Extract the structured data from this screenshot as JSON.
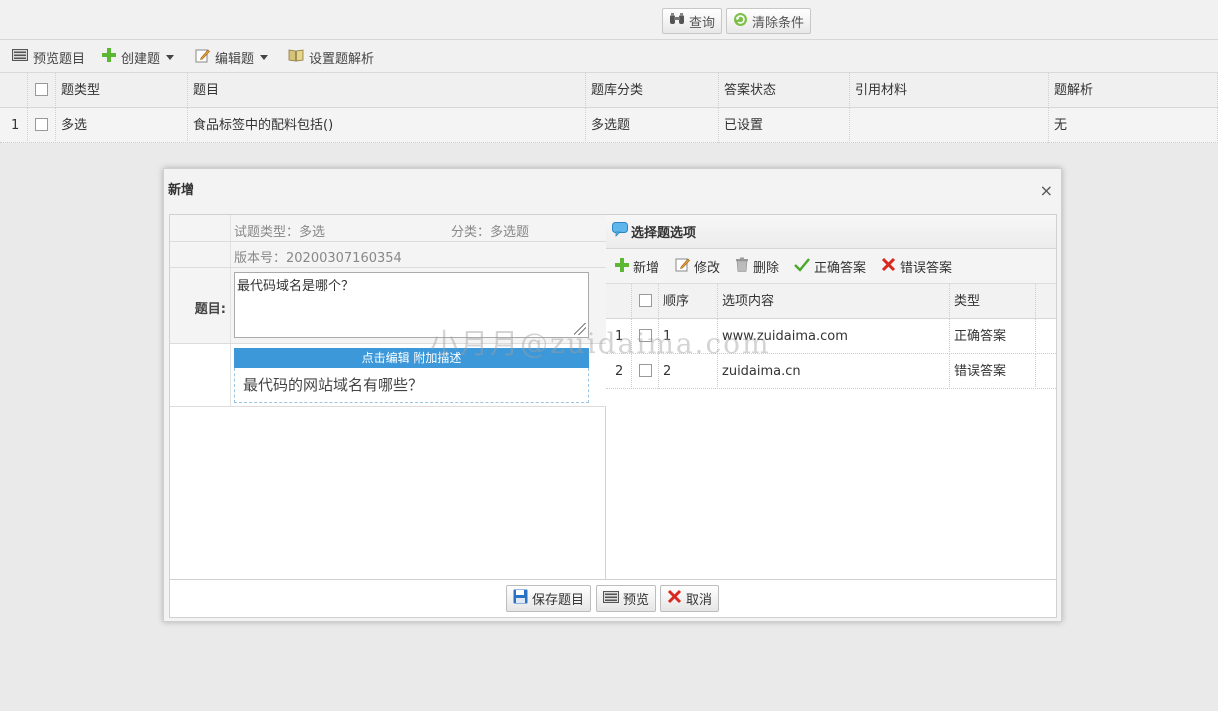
{
  "search": {
    "query_label": "查询",
    "clear_label": "清除条件"
  },
  "toolbar": {
    "preview_label": "预览题目",
    "create_label": "创建题",
    "edit_label": "编辑题",
    "analysis_label": "设置题解析"
  },
  "grid": {
    "columns": [
      "题类型",
      "题目",
      "题库分类",
      "答案状态",
      "引用材料",
      "题解析"
    ],
    "rows": [
      {
        "index": "1",
        "type": "多选",
        "title": "食品标签中的配料包括()",
        "category": "多选题",
        "answer_status": "已设置",
        "material": "",
        "analysis": "无"
      }
    ]
  },
  "dialog": {
    "title": "新增",
    "close": "×",
    "type_line": "试题类型：多选",
    "category_line": "分类：多选题",
    "version_line": "版本号：20200307160354",
    "question_label": "题目:",
    "question_value": "最代码域名是哪个？",
    "edit_bar": "点击编辑 附加描述",
    "description": "最代码的网站域名有哪些？",
    "options_panel": {
      "title": "选择题选项",
      "tools": {
        "add": "新增",
        "modify": "修改",
        "delete": "删除",
        "correct": "正确答案",
        "wrong": "错误答案"
      },
      "columns": [
        "顺序",
        "选项内容",
        "类型"
      ],
      "rows": [
        {
          "index": "1",
          "order": "1",
          "content": "www.zuidaima.com",
          "type": "正确答案"
        },
        {
          "index": "2",
          "order": "2",
          "content": "zuidaima.cn",
          "type": "错误答案"
        }
      ]
    },
    "footer": {
      "save": "保存题目",
      "preview": "预览",
      "cancel": "取消"
    }
  },
  "watermark": "小月月@zuidaima.com",
  "colors": {
    "accent": "#3c98d8",
    "add_green": "#5cb833",
    "delete_red": "#d9281e"
  }
}
